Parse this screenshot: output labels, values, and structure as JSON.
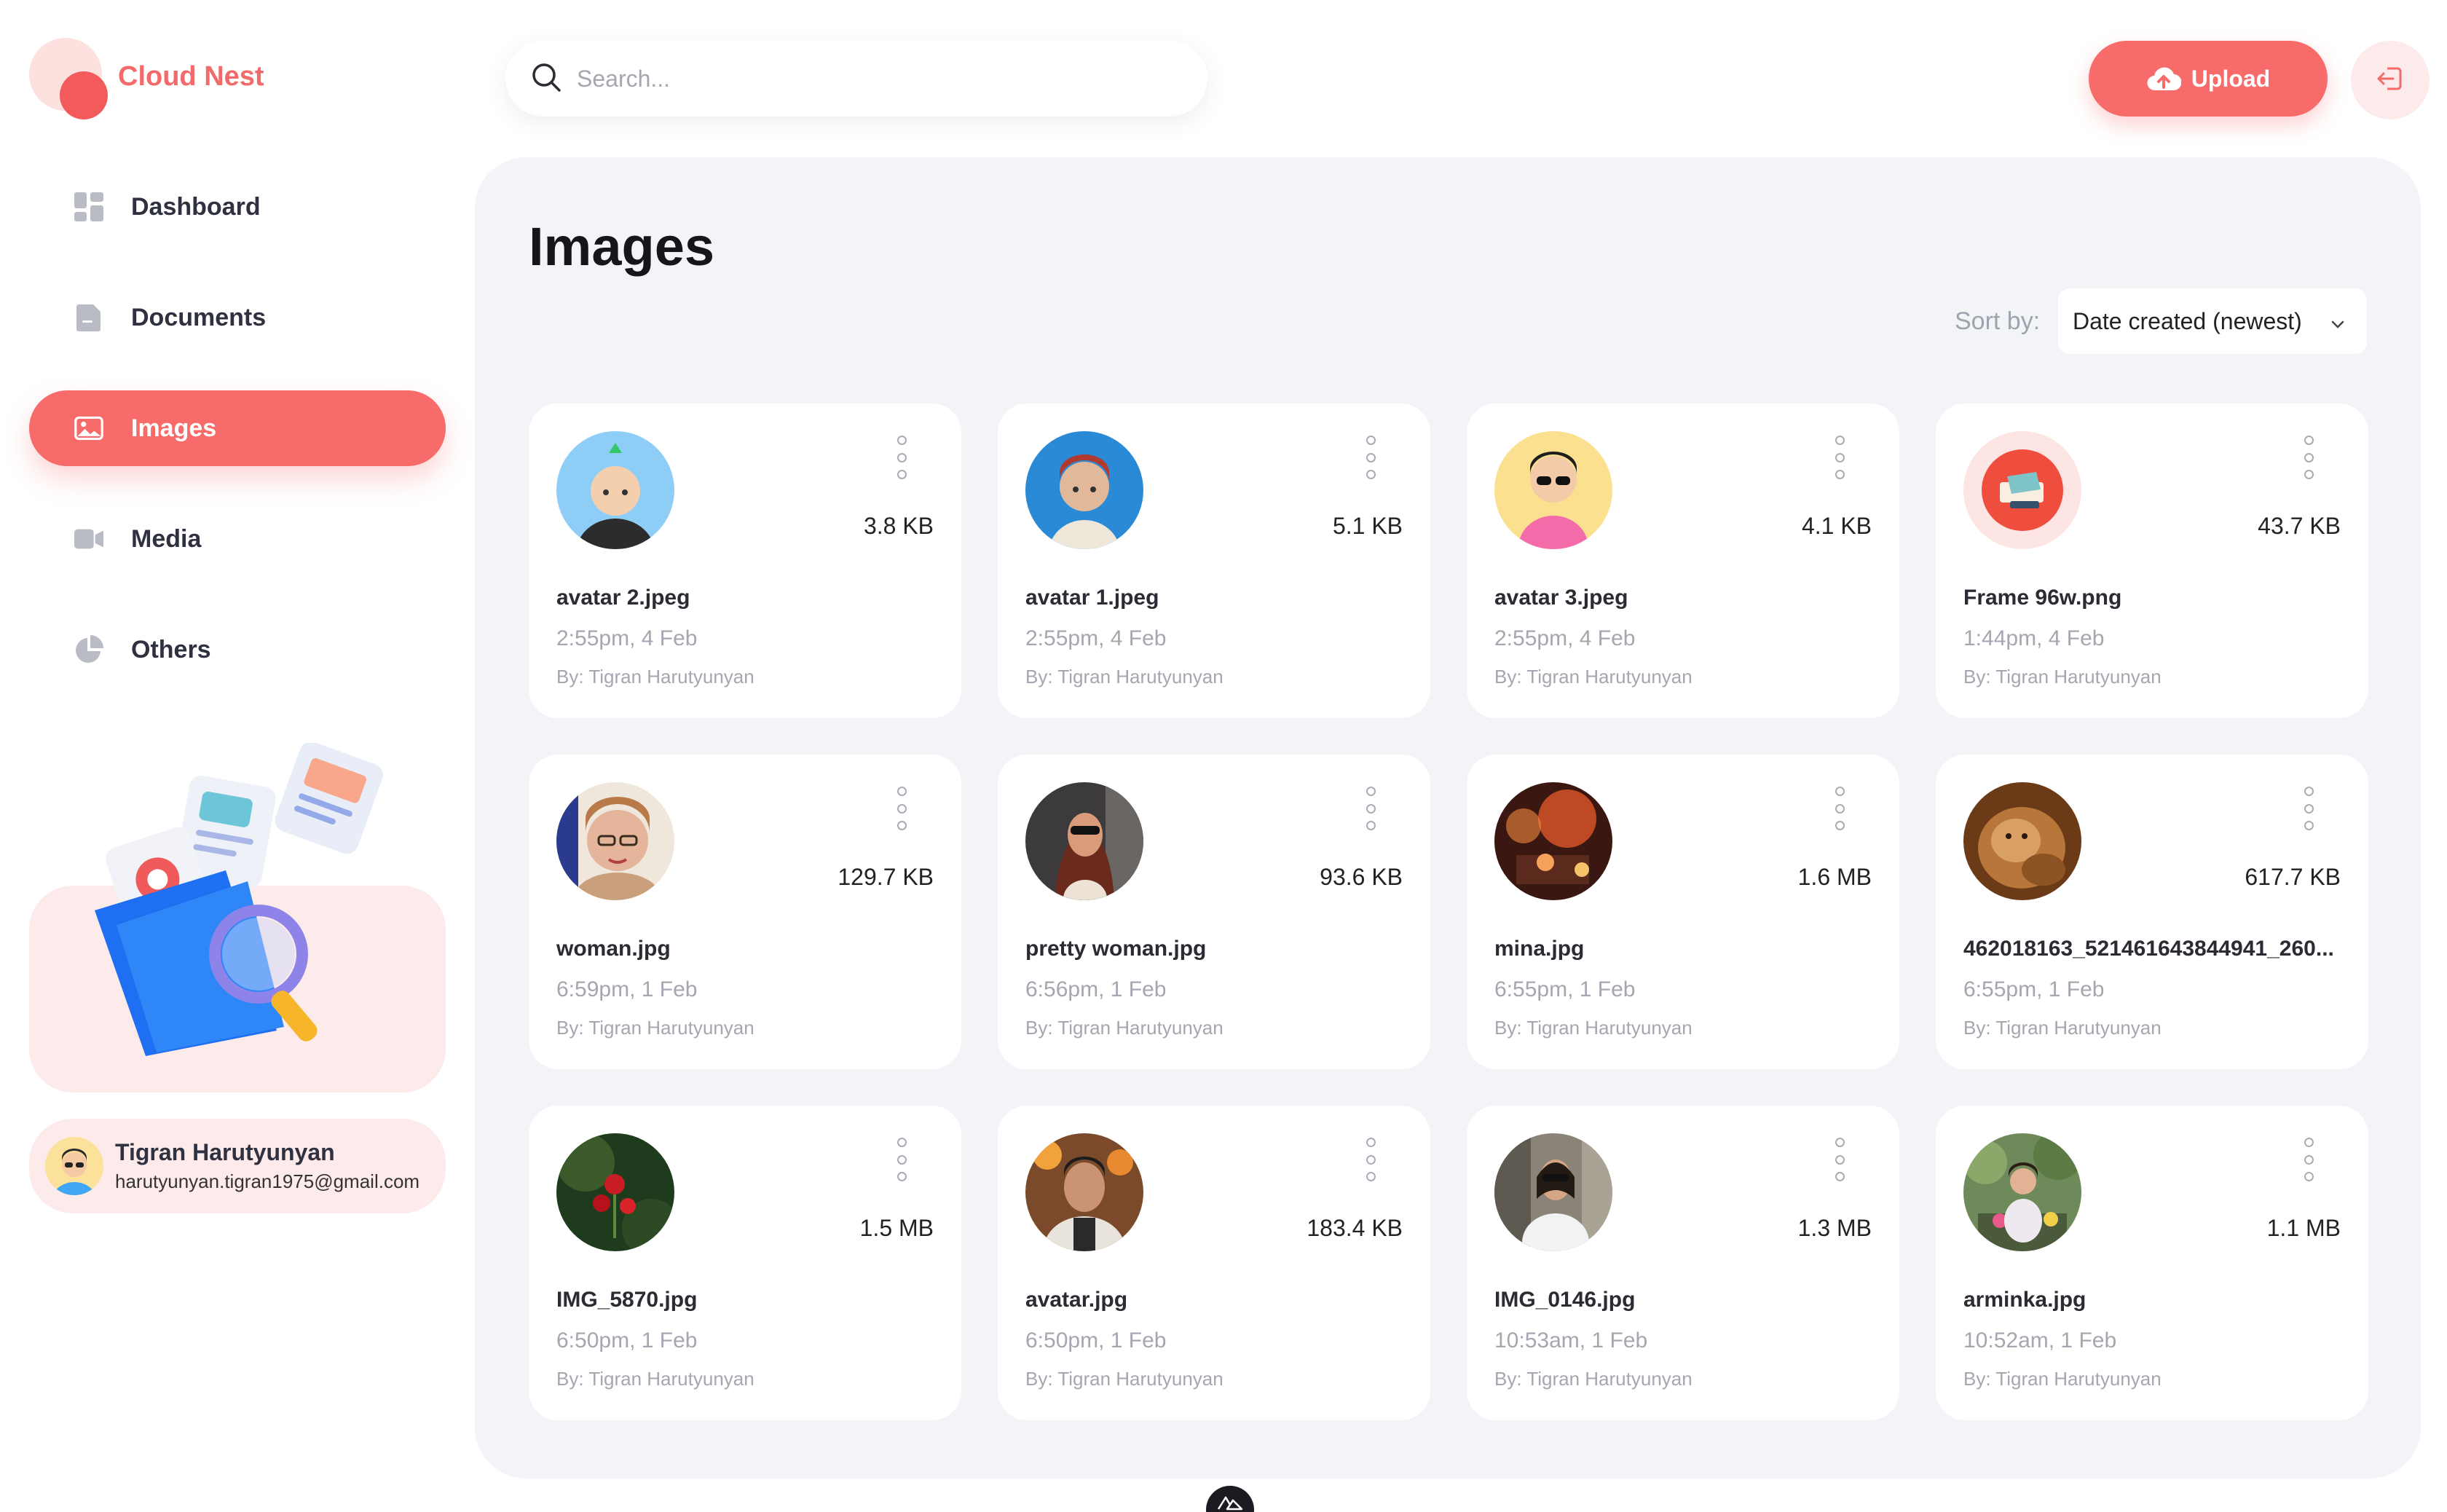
{
  "app": {
    "name": "Cloud Nest"
  },
  "colors": {
    "accent": "#f86b6b",
    "panel": "#f2f4f8",
    "muted": "#a4a7b0"
  },
  "sidebar": {
    "items": [
      {
        "label": "Dashboard",
        "icon": "dashboard-icon",
        "active": false
      },
      {
        "label": "Documents",
        "icon": "documents-icon",
        "active": false
      },
      {
        "label": "Images",
        "icon": "images-icon",
        "active": true
      },
      {
        "label": "Media",
        "icon": "media-icon",
        "active": false
      },
      {
        "label": "Others",
        "icon": "others-icon",
        "active": false
      }
    ]
  },
  "user": {
    "name": "Tigran Harutyunyan",
    "email": "harutyunyan.tigran1975@gmail.com"
  },
  "header": {
    "search_placeholder": "Search...",
    "upload_label": "Upload"
  },
  "main": {
    "title": "Images",
    "sort_label": "Sort by:",
    "sort_value": "Date created (newest)"
  },
  "files": [
    {
      "name": "avatar 2.jpeg",
      "size": "3.8 KB",
      "date": "2:55pm, 4 Feb",
      "by": "By: Tigran Harutyunyan"
    },
    {
      "name": "avatar 1.jpeg",
      "size": "5.1 KB",
      "date": "2:55pm, 4 Feb",
      "by": "By: Tigran Harutyunyan"
    },
    {
      "name": "avatar 3.jpeg",
      "size": "4.1 KB",
      "date": "2:55pm, 4 Feb",
      "by": "By: Tigran Harutyunyan"
    },
    {
      "name": "Frame 96w.png",
      "size": "43.7 KB",
      "date": "1:44pm, 4 Feb",
      "by": "By: Tigran Harutyunyan"
    },
    {
      "name": "woman.jpg",
      "size": "129.7 KB",
      "date": "6:59pm, 1 Feb",
      "by": "By: Tigran Harutyunyan"
    },
    {
      "name": "pretty woman.jpg",
      "size": "93.6 KB",
      "date": "6:56pm, 1 Feb",
      "by": "By: Tigran Harutyunyan"
    },
    {
      "name": "mina.jpg",
      "size": "1.6 MB",
      "date": "6:55pm, 1 Feb",
      "by": "By: Tigran Harutyunyan"
    },
    {
      "name": "462018163_521461643844941_260...",
      "size": "617.7 KB",
      "date": "6:55pm, 1 Feb",
      "by": "By: Tigran Harutyunyan"
    },
    {
      "name": "IMG_5870.jpg",
      "size": "1.5 MB",
      "date": "6:50pm, 1 Feb",
      "by": "By: Tigran Harutyunyan"
    },
    {
      "name": "avatar.jpg",
      "size": "183.4 KB",
      "date": "6:50pm, 1 Feb",
      "by": "By: Tigran Harutyunyan"
    },
    {
      "name": "IMG_0146.jpg",
      "size": "1.3 MB",
      "date": "10:53am, 1 Feb",
      "by": "By: Tigran Harutyunyan"
    },
    {
      "name": "arminka.jpg",
      "size": "1.1 MB",
      "date": "10:52am, 1 Feb",
      "by": "By: Tigran Harutyunyan"
    }
  ]
}
